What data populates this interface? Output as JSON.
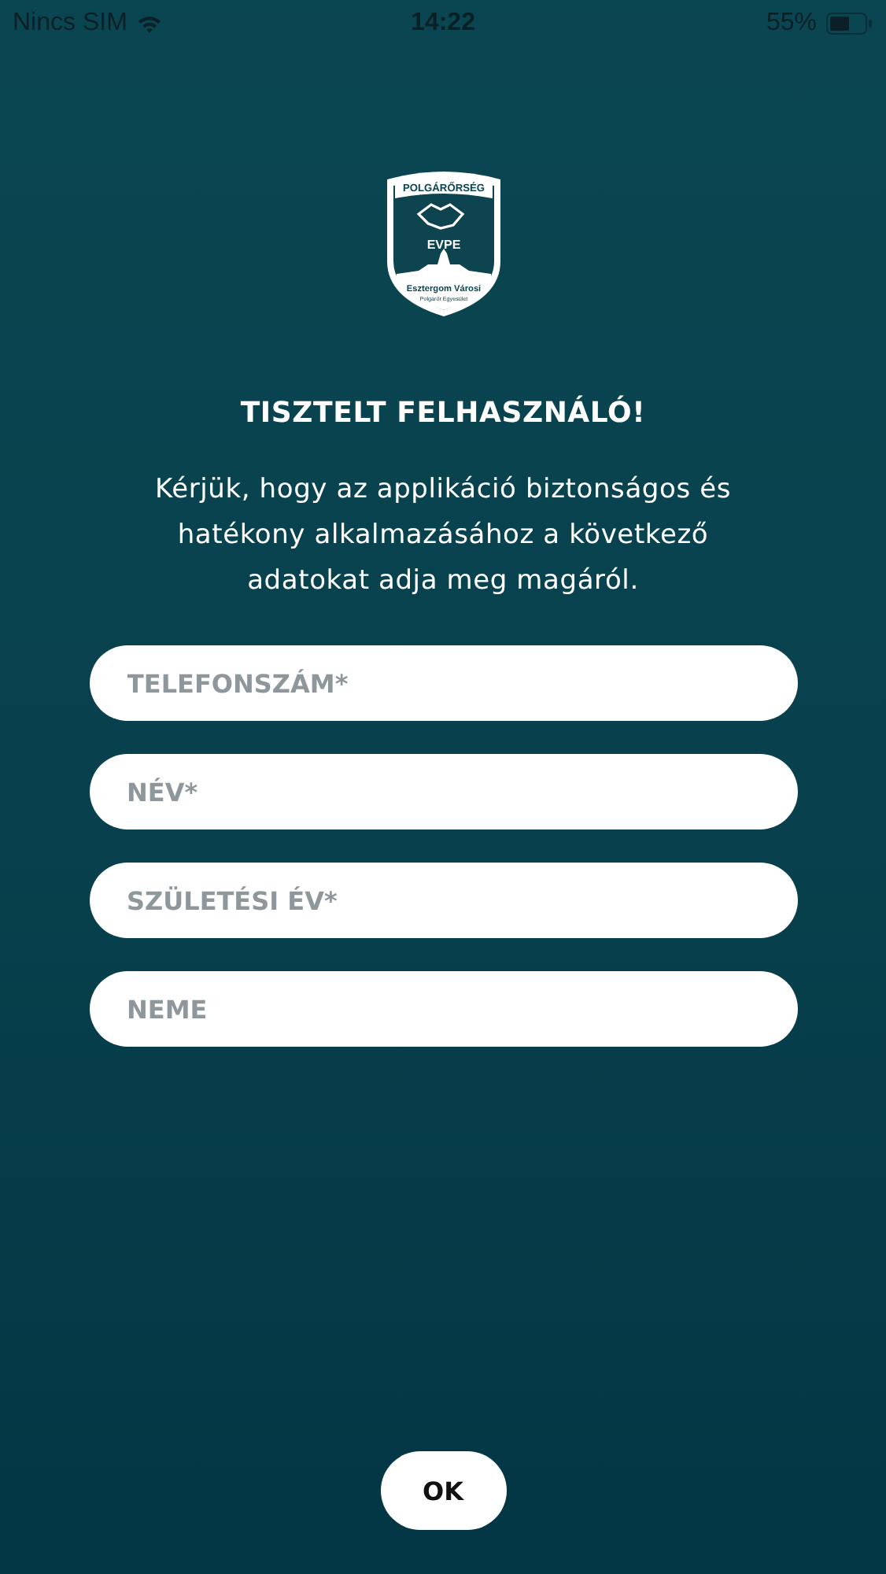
{
  "status_bar": {
    "carrier": "Nincs SIM",
    "time": "14:22",
    "battery": "55%"
  },
  "logo": {
    "banner": "POLGÁRŐRSÉG",
    "name": "EVPE",
    "city": "Esztergom Városi",
    "org": "Polgárőr Egyesület"
  },
  "title": "TISZTELT FELHASZNÁLÓ!",
  "intro": "Kérjük, hogy az applikáció biztonságos és hatékony alkalmazásához a következő adatokat adja meg magáról.",
  "fields": [
    {
      "placeholder": "TELEFONSZÁM*"
    },
    {
      "placeholder": "NÉV*"
    },
    {
      "placeholder": "SZÜLETÉSI ÉV*"
    },
    {
      "placeholder": "NEME"
    }
  ],
  "ok_button": "OK"
}
